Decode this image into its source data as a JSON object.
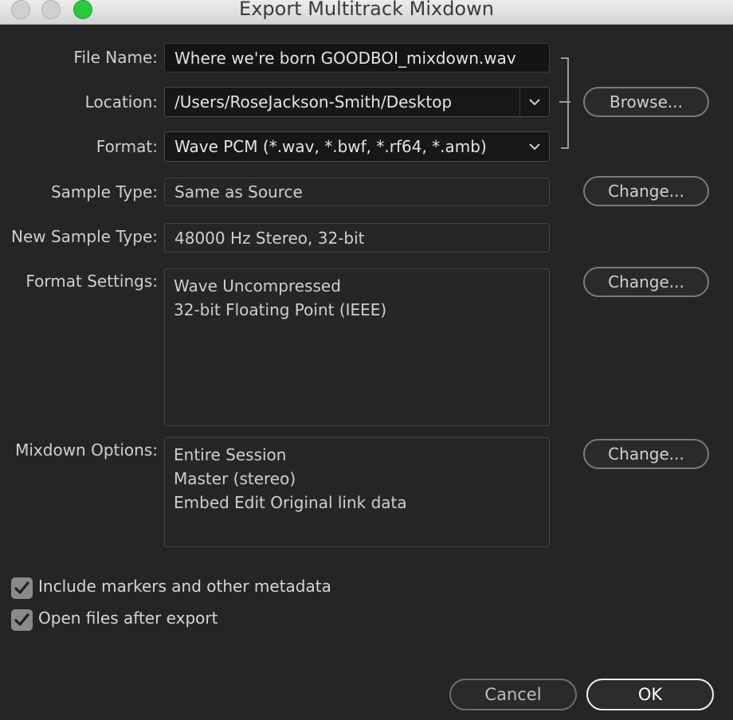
{
  "window": {
    "title": "Export Multitrack Mixdown",
    "traffic_lights": [
      "close",
      "minimize",
      "zoom"
    ]
  },
  "file_name": {
    "label": "File Name:",
    "value": "Where we're born GOODBOI_mixdown.wav"
  },
  "location": {
    "label": "Location:",
    "value": "/Users/RoseJackson-Smith/Desktop",
    "browse_label": "Browse..."
  },
  "format": {
    "label": "Format:",
    "value": "Wave PCM (*.wav, *.bwf, *.rf64, *.amb)"
  },
  "sample_type": {
    "label": "Sample Type:",
    "value": "Same as Source",
    "change_label": "Change..."
  },
  "new_sample_type": {
    "label": "New Sample Type:",
    "value": "48000 Hz Stereo, 32-bit"
  },
  "format_settings": {
    "label": "Format Settings:",
    "lines": [
      "Wave Uncompressed",
      "32-bit Floating Point (IEEE)"
    ],
    "change_label": "Change..."
  },
  "mixdown_options": {
    "label": "Mixdown Options:",
    "lines": [
      "Entire Session",
      "Master (stereo)",
      "Embed Edit Original link data"
    ],
    "change_label": "Change..."
  },
  "checkboxes": {
    "include_markers": {
      "label": "Include markers and other metadata",
      "checked": true
    },
    "open_files": {
      "label": "Open files after export",
      "checked": true
    }
  },
  "footer": {
    "cancel_label": "Cancel",
    "ok_label": "OK"
  },
  "colors": {
    "background": "#252525",
    "zoom_green": "#27c93f",
    "checkbox": "#8a8a8a"
  }
}
